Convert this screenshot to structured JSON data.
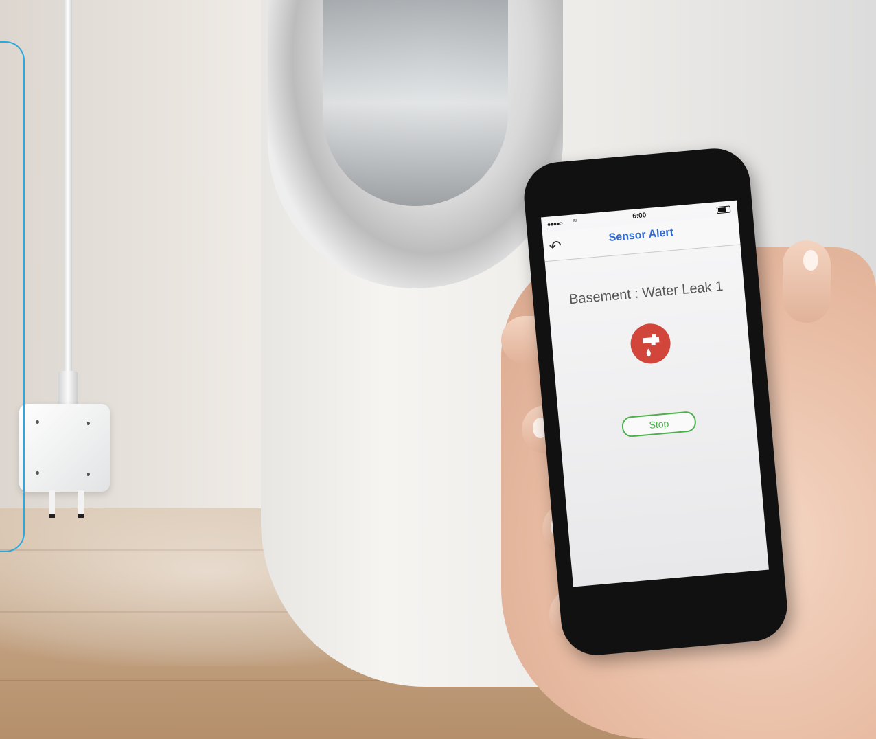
{
  "phone": {
    "status": {
      "signal": "●●●●○",
      "time": "6:00"
    },
    "nav": {
      "title": "Sensor Alert",
      "back_icon": "back-arrow-icon"
    },
    "alert": {
      "message": "Basement : Water Leak 1",
      "icon": "water-tap-drop-icon",
      "icon_color": "#d2453a"
    },
    "stop_label": "Stop",
    "colors": {
      "title": "#2f6bd3",
      "stop": "#4db04d"
    }
  },
  "scene": {
    "frame_color": "#29a9e1"
  }
}
